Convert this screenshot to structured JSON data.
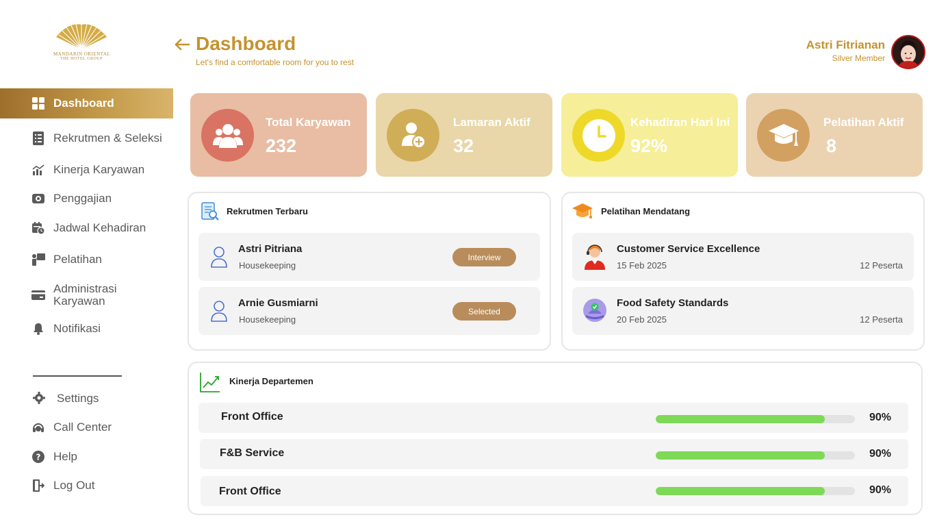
{
  "brand": {
    "line1": "MANDARIN ORIENTAL",
    "line2": "THE HOTEL GROUP",
    "gold": "#c5922e"
  },
  "header": {
    "title": "Dashboard",
    "subtitle": "Let's find a comfortable room for you to rest",
    "user_name": "Astri Fitrianan",
    "user_role": "Silver Member"
  },
  "sidebar": {
    "items": [
      {
        "label": "Dashboard",
        "icon": "grid-icon",
        "active": true
      },
      {
        "label": "Rekrutmen & Seleksi",
        "icon": "document-list-icon"
      },
      {
        "label": "Kinerja Karyawan",
        "icon": "chart-icon"
      },
      {
        "label": "Penggajian",
        "icon": "money-icon"
      },
      {
        "label": "Jadwal Kehadiran",
        "icon": "calendar-clock-icon"
      },
      {
        "label": "Pelatihan",
        "icon": "presentation-icon"
      },
      {
        "label": "Administrasi Karyawan",
        "icon": "card-icon"
      },
      {
        "label": "Notifikasi",
        "icon": "bell-icon"
      }
    ],
    "bottom_items": [
      {
        "label": "Settings",
        "icon": "gear-icon"
      },
      {
        "label": "Call Center",
        "icon": "headset-icon"
      },
      {
        "label": "Help",
        "icon": "help-icon"
      },
      {
        "label": "Log Out",
        "icon": "logout-icon"
      }
    ]
  },
  "stats": [
    {
      "label": "Total Karyawan",
      "value": "232",
      "icon": "people-icon",
      "bg": "#e8bda3",
      "circle": "#d97363"
    },
    {
      "label": "Lamaran Aktif",
      "value": "32",
      "icon": "add-user-icon",
      "bg": "#e9d7a9",
      "circle": "#d0ad57"
    },
    {
      "label": "Kehadiran Hari Ini",
      "value": "92%",
      "icon": "clock-icon",
      "bg": "#f6ee99",
      "circle": "#eed92a"
    },
    {
      "label": "Pelatihan Aktif",
      "value": "8",
      "icon": "graduation-cap-icon",
      "bg": "#ebd3b2",
      "circle": "#d2a060"
    }
  ],
  "recruitment": {
    "title": "Rekrutmen Terbaru",
    "items": [
      {
        "name": "Astri Pitriana",
        "dept": "Housekeeping",
        "status": "Interview"
      },
      {
        "name": "Arnie Gusmiarni",
        "dept": "Housekeeping",
        "status": "Selected"
      }
    ]
  },
  "training": {
    "title": "Pelatihan Mendatang",
    "items": [
      {
        "name": "Customer Service Excellence",
        "date": "15 Feb 2025",
        "participants": "12 Peserta"
      },
      {
        "name": "Food Safety Standards",
        "date": "20 Feb 2025",
        "participants": "12 Peserta"
      }
    ]
  },
  "performance": {
    "title": "Kinerja Departemen",
    "items": [
      {
        "name": "Front Office",
        "percent_label": "90%",
        "fill": 0.85
      },
      {
        "name": "F&B Service",
        "percent_label": "90%",
        "fill": 0.85
      },
      {
        "name": "Front Office",
        "percent_label": "90%",
        "fill": 0.85
      }
    ],
    "bar_color": "#7ed957"
  }
}
